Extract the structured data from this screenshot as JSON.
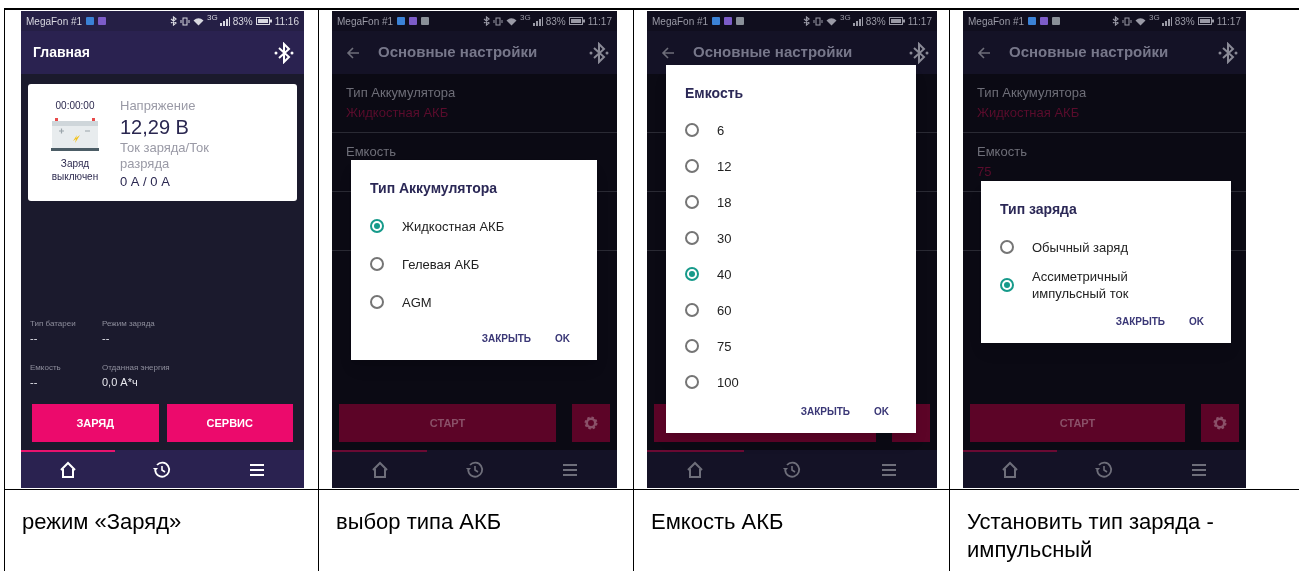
{
  "columns": [
    {
      "caption": "режим «Заряд»",
      "phone": {
        "kind": "main",
        "status_bar": {
          "carrier": "MegaFon #1",
          "notifications": [
            {
              "color": "#3b82d6"
            },
            {
              "color": "#7c5cc8"
            }
          ],
          "network": "3G",
          "battery": "83%",
          "time": "11:16"
        },
        "title": "Главная",
        "card": {
          "timer": "00:00:00",
          "charge_status": "Заряд выключен",
          "voltage_label": "Напряжение",
          "voltage": "12,29 В",
          "current_label": "Ток заряда/Ток разряда",
          "current": "0 А / 0 А"
        },
        "info": [
          {
            "label": "Тип батареи",
            "value": "--"
          },
          {
            "label": "Режим заряда",
            "value": "--"
          },
          {
            "label": "Емкость",
            "value": "--"
          },
          {
            "label": "Отданная энергия",
            "value": "0,0 А*ч"
          }
        ],
        "buttons": [
          "ЗАРЯД",
          "СЕРВИС"
        ],
        "nav": [
          {
            "kind": "home",
            "selected": true
          },
          {
            "kind": "history",
            "selected": false
          },
          {
            "kind": "menu",
            "selected": false
          }
        ]
      }
    },
    {
      "caption": "выбор типа АКБ",
      "phone": {
        "kind": "settings",
        "status_bar": {
          "carrier": "MegaFon #1",
          "notifications": [
            {
              "color": "#3b82d6"
            },
            {
              "color": "#7c5cc8"
            },
            {
              "color": "#8a9099"
            }
          ],
          "network": "3G",
          "battery": "83%",
          "time": "11:17"
        },
        "title": "Основные настройки",
        "settings": [
          {
            "label": "Тип Аккумулятора",
            "value": "Жидкостная АКБ"
          },
          {
            "label": "Емкость"
          }
        ],
        "start_button": "СТАРТ",
        "dialog": {
          "title": "Тип Аккумулятора",
          "options": [
            {
              "label": "Жидкостная АКБ",
              "selected": true
            },
            {
              "label": "Гелевая АКБ",
              "selected": false
            },
            {
              "label": "AGM",
              "selected": false
            }
          ],
          "buttons": [
            "ЗАКРЫТЬ",
            "OK"
          ]
        },
        "nav": [
          {
            "kind": "home",
            "selected": true
          },
          {
            "kind": "history",
            "selected": false
          },
          {
            "kind": "menu",
            "selected": false
          }
        ]
      }
    },
    {
      "caption": "Емкость АКБ",
      "phone": {
        "kind": "settings",
        "status_bar": {
          "carrier": "MegaFon #1",
          "notifications": [
            {
              "color": "#3b82d6"
            },
            {
              "color": "#7c5cc8"
            },
            {
              "color": "#8a9099"
            }
          ],
          "network": "3G",
          "battery": "83%",
          "time": "11:17"
        },
        "title": "Основные настройки",
        "dialog": {
          "title": "Емкость",
          "options": [
            {
              "label": "6",
              "selected": false
            },
            {
              "label": "12",
              "selected": false
            },
            {
              "label": "18",
              "selected": false
            },
            {
              "label": "30",
              "selected": false
            },
            {
              "label": "40",
              "selected": true
            },
            {
              "label": "60",
              "selected": false
            },
            {
              "label": "75",
              "selected": false
            },
            {
              "label": "100",
              "selected": false
            }
          ],
          "buttons": [
            "ЗАКРЫТЬ",
            "OK"
          ]
        },
        "nav": [
          {
            "kind": "home",
            "selected": true
          },
          {
            "kind": "history",
            "selected": false
          },
          {
            "kind": "menu",
            "selected": false
          }
        ]
      }
    },
    {
      "caption": "Установить тип заряда - импульсный",
      "phone": {
        "kind": "settings",
        "status_bar": {
          "carrier": "MegaFon #1",
          "notifications": [
            {
              "color": "#3b82d6"
            },
            {
              "color": "#7c5cc8"
            },
            {
              "color": "#8a9099"
            }
          ],
          "network": "3G",
          "battery": "83%",
          "time": "11:17"
        },
        "title": "Основные настройки",
        "settings": [
          {
            "label": "Тип Аккумулятора",
            "value": "Жидкостная АКБ"
          },
          {
            "label": "Емкость",
            "value": "75"
          }
        ],
        "start_button": "СТАРТ",
        "dialog": {
          "title": "Тип заряда",
          "options": [
            {
              "label": "Обычный заряд",
              "selected": false
            },
            {
              "label": "Ассиметричный импульсный ток",
              "selected": true
            }
          ],
          "buttons": [
            "ЗАКРЫТЬ",
            "OK"
          ]
        },
        "nav": [
          {
            "kind": "home",
            "selected": true
          },
          {
            "kind": "history",
            "selected": false
          },
          {
            "kind": "menu",
            "selected": false
          }
        ]
      }
    }
  ]
}
